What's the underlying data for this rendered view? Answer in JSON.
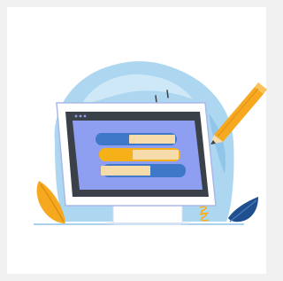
{
  "illustration": {
    "subject": "computer-monitor-with-books-and-pencil",
    "colors": {
      "page_background": "#f1f1f1",
      "card_background": "#ffffff",
      "watercolor_blob": "#9fd0ee",
      "monitor_body": "#ffffff",
      "monitor_outline": "#a9b8e8",
      "screen_bezel": "#3b4149",
      "screen": "#8e9ef0",
      "book_blue": "#3f77c9",
      "book_cream": "#f6dcaa",
      "book_yellow": "#f6b018",
      "pencil_orange": "#f6a81e",
      "leaf_orange": "#f6a81e",
      "leaf_navy": "#1f4f8f",
      "stand": "#ffffff",
      "baseline": "#8fc2e6"
    },
    "icons": [
      "window-dots-icon",
      "pencil-icon",
      "books-icon",
      "leaf-icon",
      "coil-icon"
    ]
  }
}
